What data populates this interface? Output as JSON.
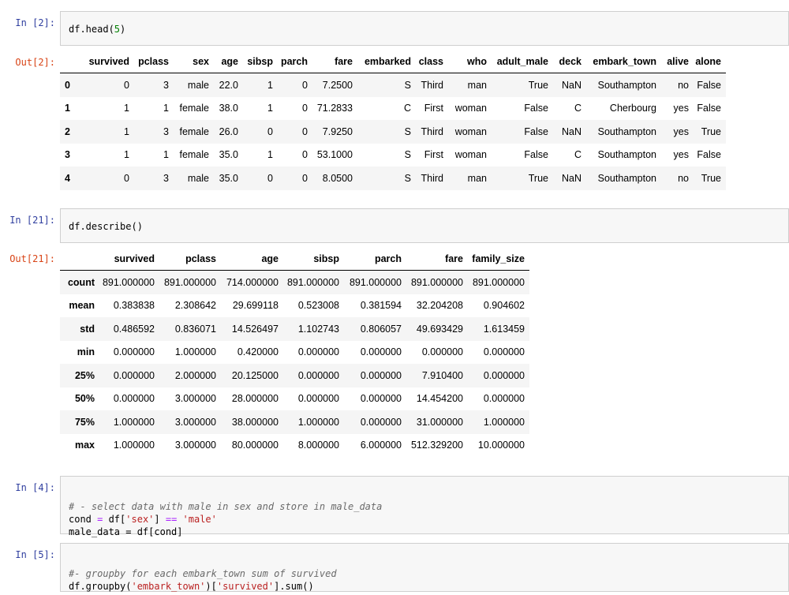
{
  "cells": [
    {
      "in_prompt": "In [2]:",
      "out_prompt": "Out[2]:",
      "code": "df.head(5)"
    },
    {
      "in_prompt": "In [21]:",
      "out_prompt": "Out[21]:",
      "code": "df.describe()"
    },
    {
      "in_prompt": "In [4]:",
      "code_lines": [
        "# - select data with male in sex and store in male_data",
        "cond = df['sex'] == 'male'",
        "male_data = df[cond]"
      ]
    },
    {
      "in_prompt": "In [5]:",
      "code_lines": [
        "#- groupby for each embark_town sum of survived",
        "df.groupby('embark_town')['survived'].sum()"
      ]
    }
  ],
  "head_table": {
    "columns": [
      "survived",
      "pclass",
      "sex",
      "age",
      "sibsp",
      "parch",
      "fare",
      "embarked",
      "class",
      "who",
      "adult_male",
      "deck",
      "embark_town",
      "alive",
      "alone"
    ],
    "rows": [
      [
        "0",
        "0",
        "3",
        "male",
        "22.0",
        "1",
        "0",
        "7.2500",
        "S",
        "Third",
        "man",
        "True",
        "NaN",
        "Southampton",
        "no",
        "False"
      ],
      [
        "1",
        "1",
        "1",
        "female",
        "38.0",
        "1",
        "0",
        "71.2833",
        "C",
        "First",
        "woman",
        "False",
        "C",
        "Cherbourg",
        "yes",
        "False"
      ],
      [
        "2",
        "1",
        "3",
        "female",
        "26.0",
        "0",
        "0",
        "7.9250",
        "S",
        "Third",
        "woman",
        "False",
        "NaN",
        "Southampton",
        "yes",
        "True"
      ],
      [
        "3",
        "1",
        "1",
        "female",
        "35.0",
        "1",
        "0",
        "53.1000",
        "S",
        "First",
        "woman",
        "False",
        "C",
        "Southampton",
        "yes",
        "False"
      ],
      [
        "4",
        "0",
        "3",
        "male",
        "35.0",
        "0",
        "0",
        "8.0500",
        "S",
        "Third",
        "man",
        "True",
        "NaN",
        "Southampton",
        "no",
        "True"
      ]
    ]
  },
  "describe_table": {
    "columns": [
      "survived",
      "pclass",
      "age",
      "sibsp",
      "parch",
      "fare",
      "family_size"
    ],
    "rows": [
      [
        "count",
        "891.000000",
        "891.000000",
        "714.000000",
        "891.000000",
        "891.000000",
        "891.000000",
        "891.000000"
      ],
      [
        "mean",
        "0.383838",
        "2.308642",
        "29.699118",
        "0.523008",
        "0.381594",
        "32.204208",
        "0.904602"
      ],
      [
        "std",
        "0.486592",
        "0.836071",
        "14.526497",
        "1.102743",
        "0.806057",
        "49.693429",
        "1.613459"
      ],
      [
        "min",
        "0.000000",
        "1.000000",
        "0.420000",
        "0.000000",
        "0.000000",
        "0.000000",
        "0.000000"
      ],
      [
        "25%",
        "0.000000",
        "2.000000",
        "20.125000",
        "0.000000",
        "0.000000",
        "7.910400",
        "0.000000"
      ],
      [
        "50%",
        "0.000000",
        "3.000000",
        "28.000000",
        "0.000000",
        "0.000000",
        "14.454200",
        "0.000000"
      ],
      [
        "75%",
        "1.000000",
        "3.000000",
        "38.000000",
        "1.000000",
        "0.000000",
        "31.000000",
        "1.000000"
      ],
      [
        "max",
        "1.000000",
        "3.000000",
        "80.000000",
        "8.000000",
        "6.000000",
        "512.329200",
        "10.000000"
      ]
    ]
  }
}
